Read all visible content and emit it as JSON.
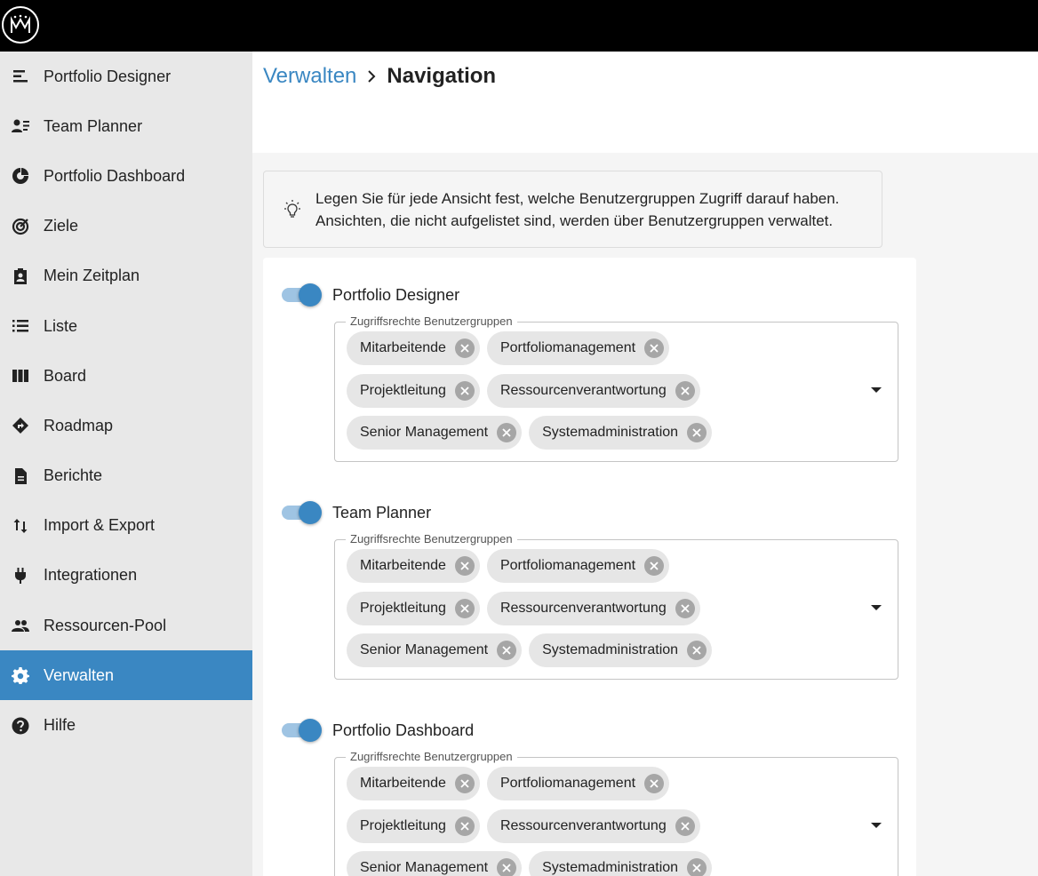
{
  "sidebar": {
    "items": [
      {
        "label": "Portfolio Designer",
        "icon": "portfolio-designer-icon"
      },
      {
        "label": "Team Planner",
        "icon": "team-planner-icon"
      },
      {
        "label": "Portfolio Dashboard",
        "icon": "dashboard-icon"
      },
      {
        "label": "Ziele",
        "icon": "target-icon"
      },
      {
        "label": "Mein Zeitplan",
        "icon": "clipboard-person-icon"
      },
      {
        "label": "Liste",
        "icon": "list-icon"
      },
      {
        "label": "Board",
        "icon": "board-icon"
      },
      {
        "label": "Roadmap",
        "icon": "roadmap-icon"
      },
      {
        "label": "Berichte",
        "icon": "report-icon"
      },
      {
        "label": "Import & Export",
        "icon": "import-export-icon"
      },
      {
        "label": "Integrationen",
        "icon": "plug-icon"
      },
      {
        "label": "Ressourcen-Pool",
        "icon": "people-icon"
      },
      {
        "label": "Verwalten",
        "icon": "gear-icon",
        "active": true
      },
      {
        "label": "Hilfe",
        "icon": "help-icon"
      }
    ]
  },
  "breadcrumb": {
    "parent": "Verwalten",
    "current": "Navigation"
  },
  "info": {
    "line1": "Legen Sie für jede Ansicht fest, welche Benutzergruppen Zugriff darauf haben.",
    "line2": "Ansichten, die nicht aufgelistet sind, werden über Benutzergruppen verwaltet."
  },
  "views": [
    {
      "title": "Portfolio Designer",
      "enabled": true,
      "field_label": "Zugriffsrechte Benutzergruppen",
      "chips": [
        "Mitarbeitende",
        "Portfoliomanagement",
        "Projektleitung",
        "Ressourcenverantwortung",
        "Senior Management",
        "Systemadministration"
      ]
    },
    {
      "title": "Team Planner",
      "enabled": true,
      "field_label": "Zugriffsrechte Benutzergruppen",
      "chips": [
        "Mitarbeitende",
        "Portfoliomanagement",
        "Projektleitung",
        "Ressourcenverantwortung",
        "Senior Management",
        "Systemadministration"
      ]
    },
    {
      "title": "Portfolio Dashboard",
      "enabled": true,
      "field_label": "Zugriffsrechte Benutzergruppen",
      "chips": [
        "Mitarbeitende",
        "Portfoliomanagement",
        "Projektleitung",
        "Ressourcenverantwortung",
        "Senior Management",
        "Systemadministration"
      ]
    }
  ],
  "colors": {
    "accent": "#3a87c2",
    "topbar": "#000000",
    "sidebar": "#e8e8e8"
  }
}
